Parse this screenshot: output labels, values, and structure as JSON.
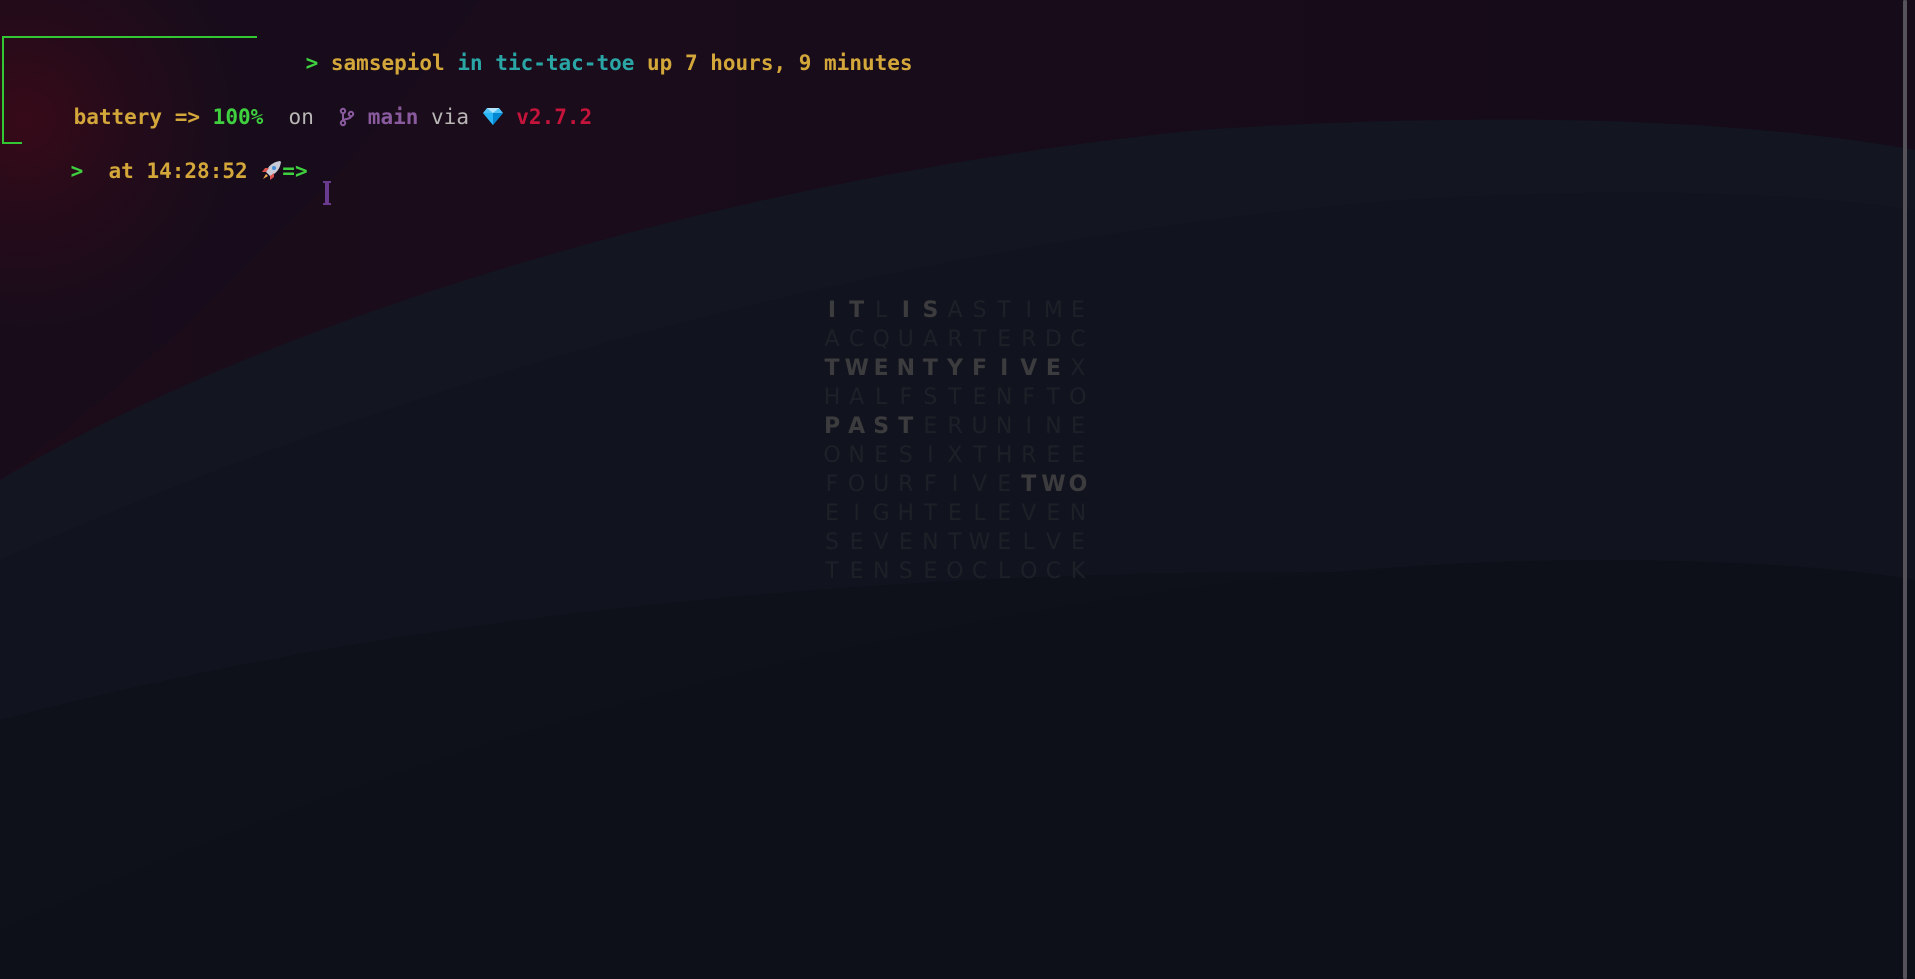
{
  "prompt": {
    "user": "samsepiol",
    "in_word": "in",
    "directory": "tic-tac-toe",
    "uptime": "up 7 hours, 9 minutes",
    "battery_label": "battery =>",
    "battery_value": "100%",
    "on_word": "on",
    "branch": "main",
    "via_word": "via",
    "version": "v2.7.2",
    "at_word": "at",
    "time": "14:28:52",
    "prompt_symbol": "=>",
    "top_arrow": "─>",
    "bottom_arrow": "─>"
  },
  "word_clock": {
    "rows": [
      "ITLISASTIME",
      "ACQUARTERDC",
      "TWENTYFIVEX",
      "HALFSTENFTO",
      "PASTERUNINE",
      "ONESIXTHREE",
      "FOURFIVETWO",
      "EIGHTELEVEN",
      "SEVENTWELVE",
      "TENSEOCLOCK"
    ],
    "lit": [
      [
        0,
        1,
        3,
        4
      ],
      [],
      [
        0,
        1,
        2,
        3,
        4,
        5,
        6,
        7,
        8,
        9
      ],
      [],
      [
        0,
        1,
        2,
        3
      ],
      [],
      [
        8,
        9,
        10
      ],
      [],
      [],
      []
    ]
  },
  "colors": {
    "green": "#3fd03f",
    "yellow": "#d3a73a",
    "cyan": "#2aa6a6",
    "purple": "#8a5a9e",
    "red": "#c4143b",
    "background_dark": "#0e111a",
    "background_red": "#2a0a14"
  },
  "icons": [
    "branch-icon",
    "gem-icon",
    "rocket-icon",
    "text-cursor-icon"
  ]
}
